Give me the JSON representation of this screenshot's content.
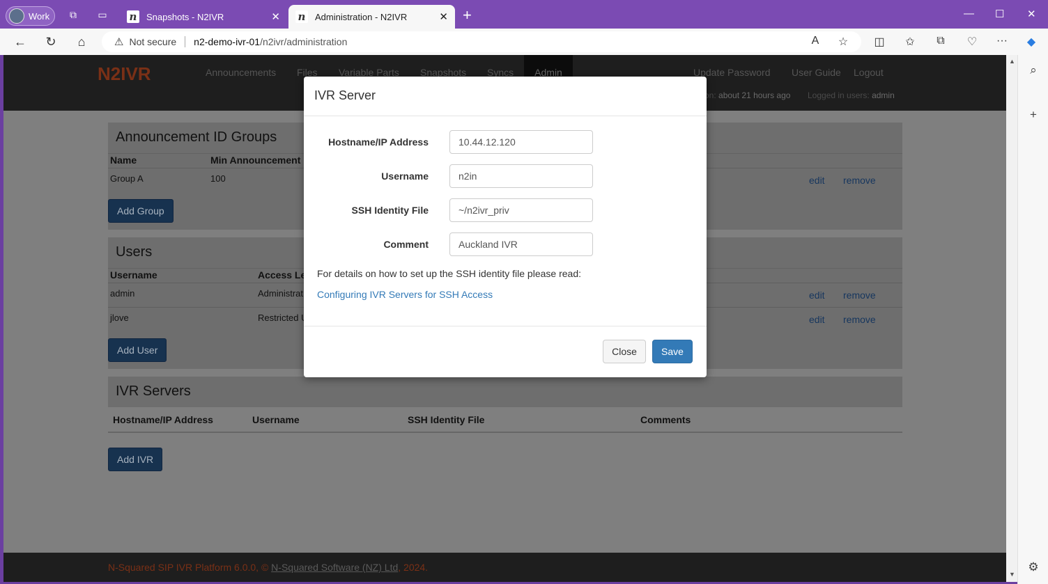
{
  "browser": {
    "profile_label": "Work",
    "tabs": [
      {
        "title": "Snapshots - N2IVR",
        "favicon": "n"
      },
      {
        "title": "Administration - N2IVR",
        "favicon": "n"
      }
    ],
    "security_label": "Not secure",
    "url_host": "n2-demo-ivr-01",
    "url_path": "/n2ivr/administration"
  },
  "app": {
    "brand": "N2IVR",
    "nav": [
      "Announcements",
      "Files",
      "Variable Parts",
      "Snapshots",
      "Syncs",
      "Admin"
    ],
    "nav_right": [
      "Update Password",
      "User Guide",
      "Logout"
    ],
    "status_prefix": "on:",
    "status_value": "about 21 hours ago",
    "logged_in_label": "Logged in users:",
    "logged_in_value": "admin"
  },
  "groups_panel": {
    "title": "Announcement ID Groups",
    "columns": [
      "Name",
      "Min Announcement"
    ],
    "rows": [
      {
        "name": "Group A",
        "min": "100",
        "edit": "edit",
        "remove": "remove"
      }
    ],
    "add_button": "Add Group"
  },
  "users_panel": {
    "title": "Users",
    "columns": [
      "Username",
      "Access Le"
    ],
    "rows": [
      {
        "username": "admin",
        "access": "Administrat",
        "edit": "edit",
        "remove": "remove"
      },
      {
        "username": "jlove",
        "access": "Restricted U",
        "edit": "edit",
        "remove": "remove"
      }
    ],
    "add_button": "Add User"
  },
  "ivr_panel": {
    "title": "IVR Servers",
    "columns": [
      "Hostname/IP Address",
      "Username",
      "SSH Identity File",
      "Comments"
    ],
    "add_button": "Add IVR"
  },
  "footer": {
    "text_before": "N-Squared SIP IVR Platform 6.0.0, © ",
    "company": "N-Squared Software (NZ) Ltd",
    "text_after": ", 2024."
  },
  "modal": {
    "title": "IVR Server",
    "fields": [
      {
        "label": "Hostname/IP Address",
        "value": "10.44.12.120"
      },
      {
        "label": "Username",
        "value": "n2in"
      },
      {
        "label": "SSH Identity File",
        "value": "~/n2ivr_priv"
      },
      {
        "label": "Comment",
        "value": "Auckland IVR"
      }
    ],
    "help_text": "For details on how to set up the SSH identity file please read:",
    "help_link": "Configuring IVR Servers for SSH Access",
    "close_label": "Close",
    "save_label": "Save"
  },
  "colors": {
    "brand": "#e8562a",
    "primary": "#337ab7",
    "browser_frame": "#7b4bb3"
  }
}
